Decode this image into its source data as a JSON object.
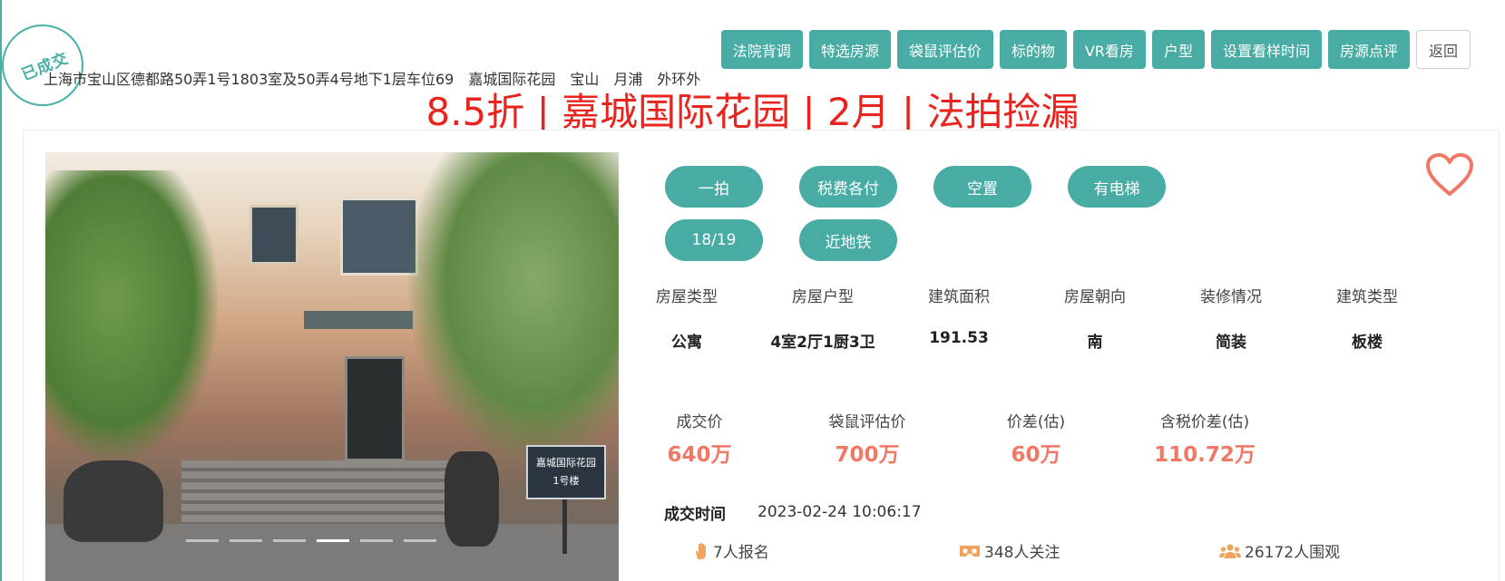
{
  "stamp": {
    "text": "已成交",
    "color": "#49b0a8"
  },
  "address": {
    "full": "上海市宝山区德都路50弄1号1803室及50弄4号地下1层车位69",
    "community": "嘉城国际花园",
    "district": "宝山",
    "area": "月浦",
    "ring": "外环外"
  },
  "toolbar": {
    "buttons": [
      "法院背调",
      "特选房源",
      "袋鼠评估价",
      "标的物",
      "VR看房",
      "户型",
      "设置看样时间",
      "房源点评"
    ],
    "back_label": "返回"
  },
  "headline": "8.5折 | 嘉城国际花园 | 2月 | 法拍捡漏",
  "photo": {
    "sign_line1": "嘉城国际花园",
    "sign_line2": "1号楼",
    "slide_count": 6,
    "active_slide": 4
  },
  "tags": [
    "一拍",
    "税费各付",
    "空置",
    "有电梯",
    "18/19",
    "近地铁"
  ],
  "attributes": [
    {
      "label": "房屋类型",
      "value": "公寓"
    },
    {
      "label": "房屋户型",
      "value": "4室2厅1厨3卫"
    },
    {
      "label": "建筑面积",
      "value": "191.53"
    },
    {
      "label": "房屋朝向",
      "value": "南"
    },
    {
      "label": "装修情况",
      "value": "简装"
    },
    {
      "label": "建筑类型",
      "value": "板楼"
    }
  ],
  "prices": [
    {
      "label": "成交价",
      "value": "640万"
    },
    {
      "label": "袋鼠评估价",
      "value": "700万"
    },
    {
      "label": "价差(估)",
      "value": "60万"
    },
    {
      "label": "含税价差(估)",
      "value": "110.72万"
    }
  ],
  "deal": {
    "label": "成交时间",
    "value": "2023-02-24 10:06:17"
  },
  "stats": {
    "signups": "7人报名",
    "followers": "348人关注",
    "viewers": "26172人围观"
  },
  "colors": {
    "accent": "#49aca4",
    "headline": "#e8241f",
    "price": "#ef7866",
    "heart": "#ef7866",
    "stat_icon": "#f0a35a"
  },
  "icons": {
    "favorite": "heart-icon",
    "signups": "hand-icon",
    "followers": "vr-glasses-icon",
    "viewers": "people-icon"
  }
}
